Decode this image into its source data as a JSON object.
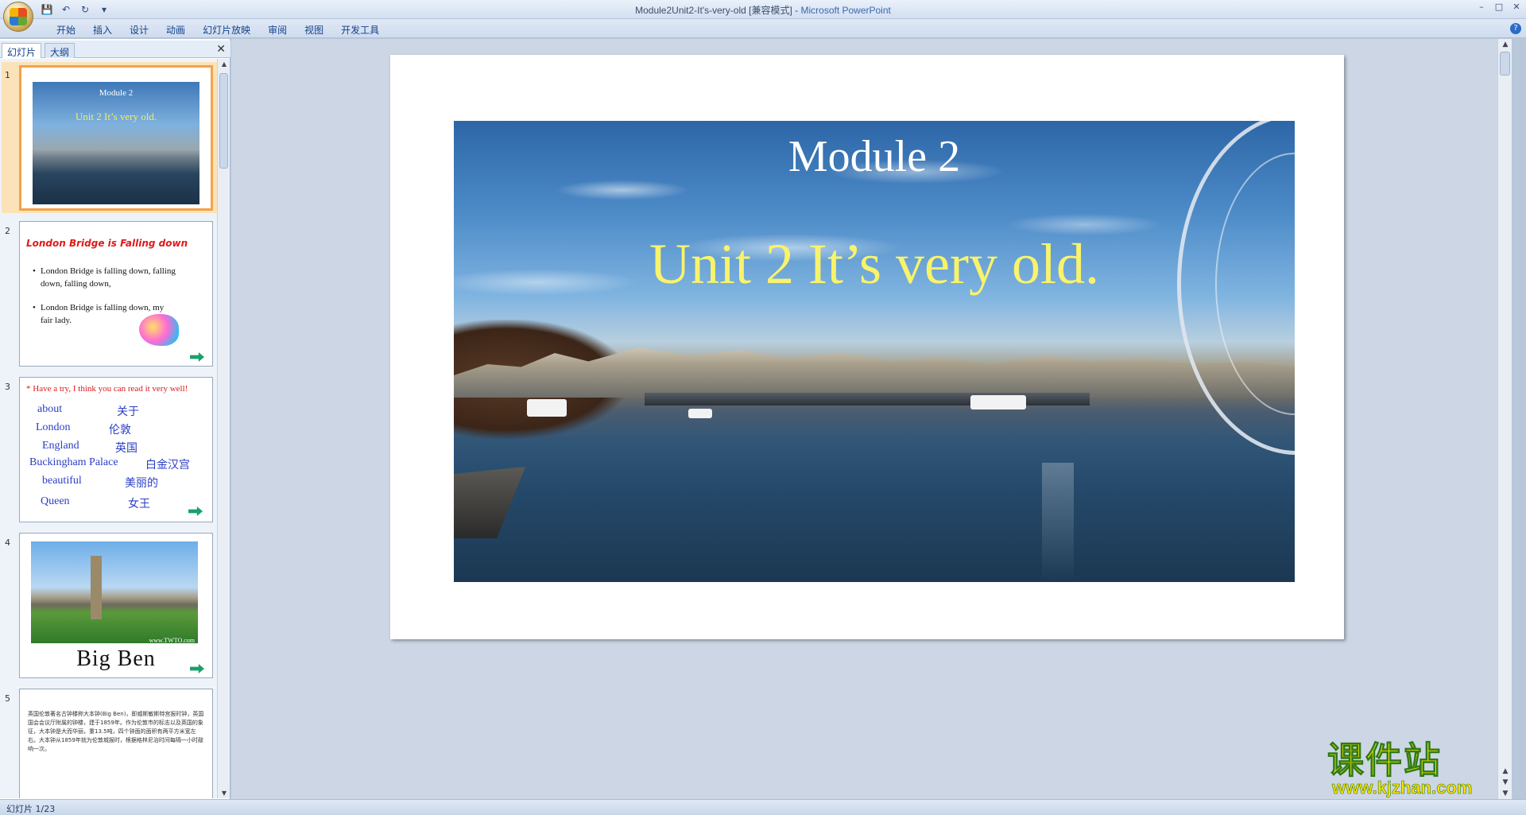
{
  "window": {
    "doc_title": "Module2Unit2-It's-very-old [兼容模式]",
    "separator": " - ",
    "app_name": "Microsoft PowerPoint"
  },
  "ribbon": {
    "tabs": [
      "开始",
      "插入",
      "设计",
      "动画",
      "幻灯片放映",
      "审阅",
      "视图",
      "开发工具"
    ]
  },
  "left_pane": {
    "tabs": [
      "幻灯片",
      "大纲"
    ],
    "slides": [
      {
        "num": "1",
        "title": "Module 2",
        "subtitle": "Unit 2 It’s very old."
      },
      {
        "num": "2",
        "title": "London Bridge is Falling down",
        "bullets": [
          "London Bridge is falling down, falling down, falling down,",
          "London Bridge is falling down, my fair lady."
        ]
      },
      {
        "num": "3",
        "top": "* Have a try, I think you can read it very well!",
        "pairs": [
          [
            "about",
            "关于"
          ],
          [
            "London",
            "伦敦"
          ],
          [
            "England",
            "英国"
          ],
          [
            "Buckingham Palace",
            "白金汉宫"
          ],
          [
            "beautiful",
            "美丽的"
          ],
          [
            "Queen",
            "女王"
          ]
        ]
      },
      {
        "num": "4",
        "caption": "Big Ben",
        "watermark": "www.TWTO.com"
      },
      {
        "num": "5",
        "text": "英国伦敦著名古钟楼称大本钟(Big Ben)，即威斯敏斯特宫报时钟，英国国会会议厅附属的钟楼，建于1859年。作为伦敦市的标志以及英国的象征，大本钟是大而华丽，重13.5吨，四个钟面的面积有两平方米宽左右。大本钟从1859年就为伦敦城报时，根据格林尼治时间每隔一小时敲响一次。"
      }
    ]
  },
  "slide": {
    "title": "Module 2",
    "subtitle": "Unit 2 It’s very old."
  },
  "watermark": {
    "brand": "课件站",
    "url": "www.kjzhan.com"
  },
  "status": {
    "text": "幻灯片 1/23"
  },
  "colors": {
    "subtitle_yellow": "#f9f36b",
    "thumb_selected": "#f2a34b",
    "thumb2_title_red": "#e01919",
    "thumb3_blue": "#2a3ec3"
  }
}
